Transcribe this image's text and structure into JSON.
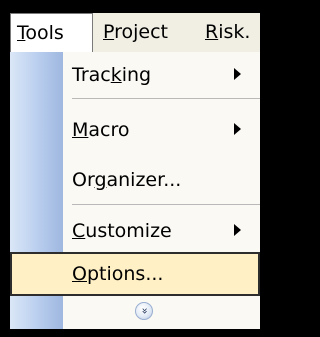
{
  "menubar": {
    "items": [
      {
        "label": "Tools",
        "mnemonic": "T",
        "rest": "ools"
      },
      {
        "label": "Project",
        "mnemonic": "P",
        "rest": "roject"
      },
      {
        "label": "Risk",
        "mnemonic": "R",
        "rest": "isk."
      }
    ]
  },
  "menu": {
    "items": [
      {
        "label": "Tracking",
        "before": "Trac",
        "mnemonic": "k",
        "after": "ing",
        "submenu": true
      },
      {
        "label": "Macro",
        "before": "",
        "mnemonic": "M",
        "after": "acro",
        "submenu": true
      },
      {
        "label": "Organizer...",
        "before": "Or",
        "mnemonic": "g",
        "after": "anizer...",
        "submenu": false
      },
      {
        "label": "Customize",
        "before": "",
        "mnemonic": "C",
        "after": "ustomize",
        "submenu": true
      },
      {
        "label": "Options...",
        "before": "",
        "mnemonic": "O",
        "after": "ptions...",
        "submenu": false
      }
    ],
    "expand_icon": "chevron-double-down-icon",
    "expand_glyph": "»"
  },
  "colors": {
    "highlight_fill": "#fff0c6",
    "gutter": "#b8cdee",
    "menubar_bg": "#f1efe4"
  }
}
